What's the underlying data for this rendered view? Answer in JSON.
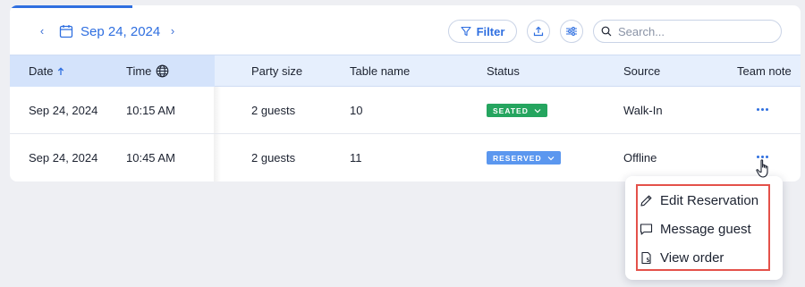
{
  "toolbar": {
    "date": "Sep 24, 2024",
    "filter_label": "Filter",
    "search_placeholder": "Search..."
  },
  "columns": {
    "date": "Date",
    "time": "Time",
    "party_size": "Party size",
    "table_name": "Table name",
    "status": "Status",
    "source": "Source",
    "team_note": "Team note"
  },
  "rows": [
    {
      "date": "Sep 24, 2024",
      "time": "10:15 AM",
      "party_size": "2 guests",
      "table_name": "10",
      "status": "SEATED",
      "status_color": "#25a55f",
      "source": "Walk-In"
    },
    {
      "date": "Sep 24, 2024",
      "time": "10:45 AM",
      "party_size": "2 guests",
      "table_name": "11",
      "status": "RESERVED",
      "status_color": "#5b97ef",
      "source": "Offline"
    }
  ],
  "context_menu": {
    "items": [
      {
        "label": "Edit Reservation",
        "icon": "pencil-icon"
      },
      {
        "label": "Message guest",
        "icon": "chat-bubble-icon"
      },
      {
        "label": "View order",
        "icon": "order-document-icon"
      }
    ],
    "highlight_color": "#e4514a"
  },
  "colors": {
    "accent": "#2f6fe0",
    "header_bg": "#e6effd",
    "page_bg": "#eeeff3"
  }
}
